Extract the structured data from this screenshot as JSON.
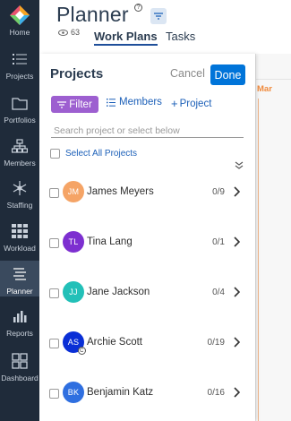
{
  "sidebar": {
    "logo_label": "Home",
    "items": [
      {
        "label": "Projects",
        "icon": "list-icon"
      },
      {
        "label": "Portfolios",
        "icon": "folder-icon"
      },
      {
        "label": "Members",
        "icon": "org-chart-icon"
      },
      {
        "label": "Staffing",
        "icon": "snowflake-icon"
      },
      {
        "label": "Workload",
        "icon": "grid-icon"
      },
      {
        "label": "Planner",
        "icon": "planner-icon",
        "active": true
      },
      {
        "label": "Reports",
        "icon": "bar-chart-icon"
      },
      {
        "label": "Dashboard",
        "icon": "dashboard-icon"
      }
    ]
  },
  "header": {
    "title": "Planner",
    "help": "?",
    "view_count": "63",
    "tabs": [
      {
        "label": "Work Plans",
        "active": true
      },
      {
        "label": "Tasks",
        "active": false
      }
    ]
  },
  "calendar_bg": {
    "month_label": "Mar"
  },
  "panel": {
    "title": "Projects",
    "cancel_label": "Cancel",
    "done_label": "Done",
    "filter_label": "Filter",
    "members_label": "Members",
    "add_project_label": "Project",
    "add_project_prefix": "+",
    "search_placeholder": "Search project or select below",
    "select_all_label": "Select All Projects",
    "projects": [
      {
        "initials": "JM",
        "name": "James Meyers",
        "count": "0/9",
        "color": "#f5a466"
      },
      {
        "initials": "TL",
        "name": "Tina Lang",
        "count": "0/1",
        "color": "#7d2fd0"
      },
      {
        "initials": "JJ",
        "name": "Jane Jackson",
        "count": "0/4",
        "color": "#22c0b8"
      },
      {
        "initials": "AS",
        "name": "Archie Scott",
        "count": "0/19",
        "color": "#0a2fd6",
        "badge": "C"
      },
      {
        "initials": "BK",
        "name": "Benjamin Katz",
        "count": "0/16",
        "color": "#2f6fe0"
      }
    ]
  },
  "colors": {
    "sidebar_bg": "#1f2b3a",
    "accent_blue": "#0074d9",
    "filter_purple": "#9d5fd0",
    "link_blue": "#1b5fb8",
    "calendar_orange": "#f08a3c"
  }
}
